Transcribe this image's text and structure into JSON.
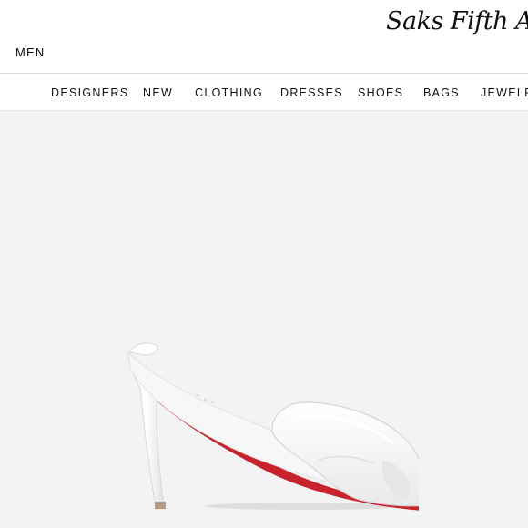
{
  "header": {
    "men_label": "MEN",
    "logo_text": "Saks Fifth Avenue"
  },
  "nav": {
    "items": [
      {
        "label": "DESIGNERS"
      },
      {
        "label": "NEW"
      },
      {
        "label": "CLOTHING"
      },
      {
        "label": "DRESSES"
      },
      {
        "label": "SHOES"
      },
      {
        "label": "BAGS"
      },
      {
        "label": "JEWELRY"
      }
    ]
  },
  "product": {
    "image_icon": "white-peep-toe-mule-icon",
    "colors": {
      "background": "#f3f3f3",
      "sole": "#c8232c",
      "upper": "#ffffff"
    }
  }
}
